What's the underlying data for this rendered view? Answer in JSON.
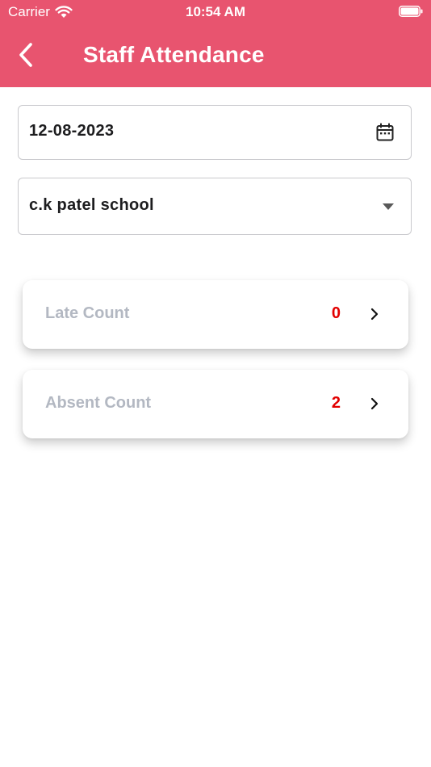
{
  "status_bar": {
    "carrier": "Carrier",
    "time": "10:54 AM"
  },
  "header": {
    "title": "Staff Attendance",
    "color": "#e8546f"
  },
  "filters": {
    "date_value": "12-08-2023",
    "school_value": "c.k patel school"
  },
  "cards": [
    {
      "label": "Late Count",
      "count": "0"
    },
    {
      "label": "Absent Count",
      "count": "2"
    }
  ],
  "colors": {
    "count": "#e20000",
    "card_label": "#b3b8c2"
  },
  "icons": {
    "back": "chevron-left-icon",
    "date": "calendar-icon",
    "school": "dropdown-arrow-icon",
    "card": "chevron-right-icon"
  }
}
